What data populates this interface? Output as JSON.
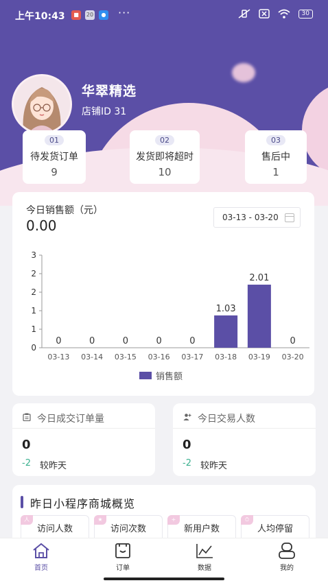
{
  "status_bar": {
    "time": "上午10:43",
    "app_badge_text": "20",
    "battery": "30",
    "dots": "···"
  },
  "shop": {
    "name": "华翠精选",
    "id_text": "店铺ID 31"
  },
  "order_stats": [
    {
      "index": "01",
      "label": "待发货订单",
      "value": "9"
    },
    {
      "index": "02",
      "label": "发货即将超时",
      "value": "10"
    },
    {
      "index": "03",
      "label": "售后中",
      "value": "1"
    }
  ],
  "sales": {
    "title": "今日销售额（元）",
    "value": "0.00",
    "date_range": "03-13 - 03-20"
  },
  "chart_data": {
    "type": "bar",
    "categories": [
      "03-13",
      "03-14",
      "03-15",
      "03-16",
      "03-17",
      "03-18",
      "03-19",
      "03-20"
    ],
    "series": [
      {
        "name": "销售额",
        "values": [
          0,
          0,
          0,
          0,
          0,
          1.03,
          2.01,
          0
        ]
      }
    ],
    "data_labels": [
      "0",
      "0",
      "0",
      "0",
      "0",
      "1.03",
      "2.01",
      "0"
    ],
    "y_ticks": [
      "0",
      "1",
      "1",
      "2",
      "2",
      "3"
    ],
    "ylim": [
      0,
      2.5
    ],
    "grid": false,
    "legend": "bottom-center",
    "bar_color": "#5b4fa6"
  },
  "mini_stats": [
    {
      "title": "今日成交订单量",
      "value": "0",
      "delta": "-2",
      "compare": "较昨天"
    },
    {
      "title": "今日交易人数",
      "value": "0",
      "delta": "-2",
      "compare": "较昨天"
    }
  ],
  "overview": {
    "title": "昨日小程序商城概览",
    "items": [
      "访问人数",
      "访问次数",
      "新用户数",
      "人均停留"
    ]
  },
  "tabbar": [
    {
      "label": "首页",
      "icon": "home-icon",
      "active": true
    },
    {
      "label": "订单",
      "icon": "order-icon",
      "active": false
    },
    {
      "label": "数据",
      "icon": "chart-icon",
      "active": false
    },
    {
      "label": "我的",
      "icon": "user-icon",
      "active": false
    }
  ],
  "colors": {
    "brand": "#5b4fa6",
    "positive_delta": "#3bb08f",
    "header_pink": "#f6dbe6"
  }
}
